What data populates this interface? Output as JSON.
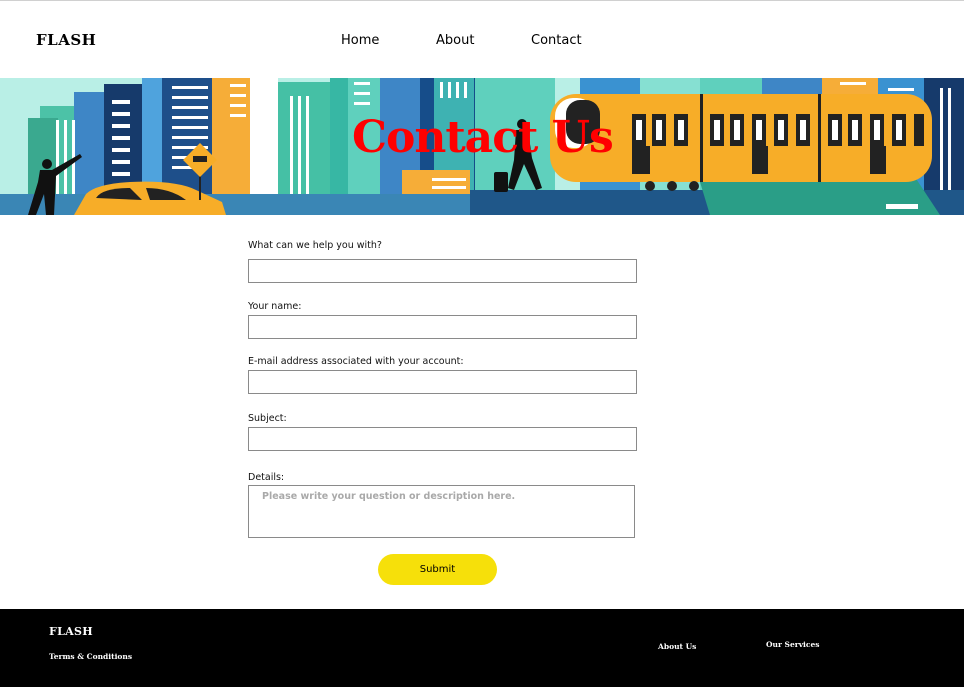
{
  "header": {
    "brand": "FLASH",
    "nav": [
      {
        "label": "Home"
      },
      {
        "label": "About"
      },
      {
        "label": "Contact"
      }
    ]
  },
  "hero": {
    "title": "Contact Us"
  },
  "form": {
    "fields": [
      {
        "label": "What can we help you with?",
        "value": ""
      },
      {
        "label": "Your name:",
        "value": ""
      },
      {
        "label": "E-mail address associated with your account:",
        "value": ""
      },
      {
        "label": "Subject:",
        "value": ""
      }
    ],
    "details": {
      "label": "Details:",
      "placeholder": "Please write your question or description here.",
      "value": ""
    },
    "submit_label": "Submit"
  },
  "footer": {
    "brand": "FLASH",
    "terms": "Terms & Conditions",
    "about": "About Us",
    "services": "Our Services"
  },
  "colors": {
    "hero_title": "#ff0000",
    "submit_bg": "#f6e00a",
    "footer_bg": "#000000",
    "hero_sky": "#b9efe6",
    "train": "#f7ad28"
  }
}
